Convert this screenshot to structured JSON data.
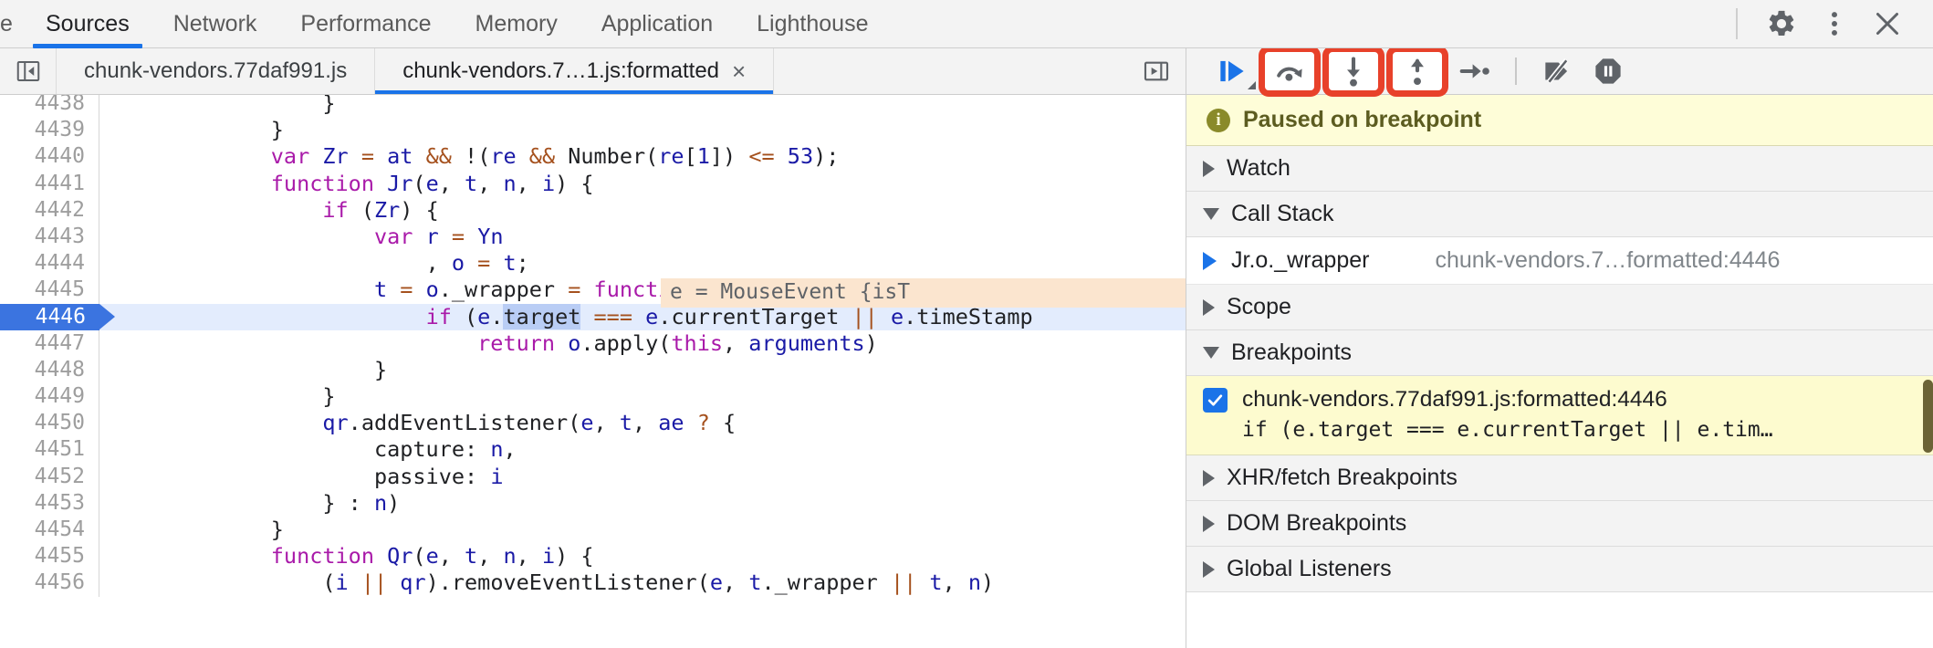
{
  "panel_tabs": [
    {
      "label": "e",
      "active": false,
      "clipped": true
    },
    {
      "label": "Sources",
      "active": true
    },
    {
      "label": "Network",
      "active": false
    },
    {
      "label": "Performance",
      "active": false
    },
    {
      "label": "Memory",
      "active": false
    },
    {
      "label": "Application",
      "active": false
    },
    {
      "label": "Lighthouse",
      "active": false
    }
  ],
  "window_controls": {
    "settings_icon": "gear-icon",
    "more_icon": "kebab-menu-icon",
    "close_icon": "close-icon"
  },
  "editor": {
    "navigator_toggle_icon": "show-navigator-icon",
    "more_tabs_icon": "more-tabs-icon",
    "tabs": [
      {
        "label": "chunk-vendors.77daf991.js",
        "active": false,
        "closable": false
      },
      {
        "label": "chunk-vendors.7…1.js:formatted",
        "active": true,
        "closable": true,
        "close_label": "×"
      }
    ],
    "inline_value_hint": "e = MouseEvent {isT",
    "execution_line": 4446,
    "selected_token": "target",
    "lines": [
      {
        "num": "4438",
        "indent": 8,
        "tokens": [
          {
            "t": "}",
            "c": "pln"
          }
        ],
        "partial_top": true
      },
      {
        "num": "4439",
        "indent": 6,
        "tokens": [
          {
            "t": "}",
            "c": "pln"
          }
        ]
      },
      {
        "num": "4440",
        "indent": 6,
        "tokens": [
          {
            "t": "var ",
            "c": "kw"
          },
          {
            "t": "Zr",
            "c": "id"
          },
          {
            "t": " ",
            "c": "pln"
          },
          {
            "t": "=",
            "c": "op"
          },
          {
            "t": " ",
            "c": "pln"
          },
          {
            "t": "at",
            "c": "id"
          },
          {
            "t": " ",
            "c": "pln"
          },
          {
            "t": "&&",
            "c": "op"
          },
          {
            "t": " ",
            "c": "pln"
          },
          {
            "t": "!(",
            "c": "pln"
          },
          {
            "t": "re",
            "c": "id"
          },
          {
            "t": " ",
            "c": "pln"
          },
          {
            "t": "&&",
            "c": "op"
          },
          {
            "t": " Number(",
            "c": "pln"
          },
          {
            "t": "re",
            "c": "id"
          },
          {
            "t": "[",
            "c": "pln"
          },
          {
            "t": "1",
            "c": "num"
          },
          {
            "t": "]) ",
            "c": "pln"
          },
          {
            "t": "<=",
            "c": "op"
          },
          {
            "t": " ",
            "c": "pln"
          },
          {
            "t": "53",
            "c": "num"
          },
          {
            "t": ");",
            "c": "pln"
          }
        ]
      },
      {
        "num": "4441",
        "indent": 6,
        "tokens": [
          {
            "t": "function ",
            "c": "kw"
          },
          {
            "t": "Jr",
            "c": "id"
          },
          {
            "t": "(",
            "c": "pln"
          },
          {
            "t": "e",
            "c": "id"
          },
          {
            "t": ", ",
            "c": "pln"
          },
          {
            "t": "t",
            "c": "id"
          },
          {
            "t": ", ",
            "c": "pln"
          },
          {
            "t": "n",
            "c": "id"
          },
          {
            "t": ", ",
            "c": "pln"
          },
          {
            "t": "i",
            "c": "id"
          },
          {
            "t": ") {",
            "c": "pln"
          }
        ]
      },
      {
        "num": "4442",
        "indent": 8,
        "tokens": [
          {
            "t": "if ",
            "c": "kw"
          },
          {
            "t": "(",
            "c": "pln"
          },
          {
            "t": "Zr",
            "c": "id"
          },
          {
            "t": ") {",
            "c": "pln"
          }
        ]
      },
      {
        "num": "4443",
        "indent": 10,
        "tokens": [
          {
            "t": "var ",
            "c": "kw"
          },
          {
            "t": "r",
            "c": "id"
          },
          {
            "t": " ",
            "c": "pln"
          },
          {
            "t": "=",
            "c": "op"
          },
          {
            "t": " ",
            "c": "pln"
          },
          {
            "t": "Yn",
            "c": "id"
          }
        ]
      },
      {
        "num": "4444",
        "indent": 12,
        "tokens": [
          {
            "t": ", ",
            "c": "pln"
          },
          {
            "t": "o",
            "c": "id"
          },
          {
            "t": " ",
            "c": "pln"
          },
          {
            "t": "=",
            "c": "op"
          },
          {
            "t": " ",
            "c": "pln"
          },
          {
            "t": "t",
            "c": "id"
          },
          {
            "t": ";",
            "c": "pln"
          }
        ]
      },
      {
        "num": "4445",
        "indent": 10,
        "tokens": [
          {
            "t": "t",
            "c": "id"
          },
          {
            "t": " ",
            "c": "pln"
          },
          {
            "t": "=",
            "c": "op"
          },
          {
            "t": " ",
            "c": "pln"
          },
          {
            "t": "o",
            "c": "id"
          },
          {
            "t": "._wrapper ",
            "c": "pln"
          },
          {
            "t": "=",
            "c": "op"
          },
          {
            "t": " ",
            "c": "pln"
          },
          {
            "t": "function",
            "c": "kw"
          },
          {
            "t": "(",
            "c": "pln"
          },
          {
            "t": "e",
            "c": "id"
          },
          {
            "t": ") {",
            "c": "pln"
          }
        ]
      },
      {
        "num": "4446",
        "indent": 12,
        "exec": true,
        "tokens": [
          {
            "t": "if ",
            "c": "kw"
          },
          {
            "t": "(",
            "c": "pln"
          },
          {
            "t": "e",
            "c": "id"
          },
          {
            "t": ".",
            "c": "pln"
          },
          {
            "t": "target",
            "c": "pln",
            "sel": true
          },
          {
            "t": " ",
            "c": "pln"
          },
          {
            "t": "===",
            "c": "op"
          },
          {
            "t": " ",
            "c": "pln"
          },
          {
            "t": "e",
            "c": "id"
          },
          {
            "t": ".currentTarget ",
            "c": "pln"
          },
          {
            "t": "||",
            "c": "op"
          },
          {
            "t": " ",
            "c": "pln"
          },
          {
            "t": "e",
            "c": "id"
          },
          {
            "t": ".timeStamp",
            "c": "pln"
          }
        ]
      },
      {
        "num": "4447",
        "indent": 14,
        "tokens": [
          {
            "t": "return ",
            "c": "kw"
          },
          {
            "t": "o",
            "c": "id"
          },
          {
            "t": ".apply(",
            "c": "pln"
          },
          {
            "t": "this",
            "c": "kw"
          },
          {
            "t": ", ",
            "c": "pln"
          },
          {
            "t": "arguments",
            "c": "id"
          },
          {
            "t": ")",
            "c": "pln"
          }
        ]
      },
      {
        "num": "4448",
        "indent": 10,
        "tokens": [
          {
            "t": "}",
            "c": "pln"
          }
        ]
      },
      {
        "num": "4449",
        "indent": 8,
        "tokens": [
          {
            "t": "}",
            "c": "pln"
          }
        ]
      },
      {
        "num": "4450",
        "indent": 8,
        "tokens": [
          {
            "t": "qr",
            "c": "id"
          },
          {
            "t": ".addEventListener(",
            "c": "pln"
          },
          {
            "t": "e",
            "c": "id"
          },
          {
            "t": ", ",
            "c": "pln"
          },
          {
            "t": "t",
            "c": "id"
          },
          {
            "t": ", ",
            "c": "pln"
          },
          {
            "t": "ae",
            "c": "id"
          },
          {
            "t": " ",
            "c": "pln"
          },
          {
            "t": "?",
            "c": "op"
          },
          {
            "t": " {",
            "c": "pln"
          }
        ]
      },
      {
        "num": "4451",
        "indent": 10,
        "tokens": [
          {
            "t": "capture: ",
            "c": "pln"
          },
          {
            "t": "n",
            "c": "id"
          },
          {
            "t": ",",
            "c": "pln"
          }
        ]
      },
      {
        "num": "4452",
        "indent": 10,
        "tokens": [
          {
            "t": "passive: ",
            "c": "pln"
          },
          {
            "t": "i",
            "c": "id"
          }
        ]
      },
      {
        "num": "4453",
        "indent": 8,
        "tokens": [
          {
            "t": "} : ",
            "c": "pln"
          },
          {
            "t": "n",
            "c": "id"
          },
          {
            "t": ")",
            "c": "pln"
          }
        ]
      },
      {
        "num": "4454",
        "indent": 6,
        "tokens": [
          {
            "t": "}",
            "c": "pln"
          }
        ]
      },
      {
        "num": "4455",
        "indent": 6,
        "tokens": [
          {
            "t": "function ",
            "c": "kw"
          },
          {
            "t": "Qr",
            "c": "id"
          },
          {
            "t": "(",
            "c": "pln"
          },
          {
            "t": "e",
            "c": "id"
          },
          {
            "t": ", ",
            "c": "pln"
          },
          {
            "t": "t",
            "c": "id"
          },
          {
            "t": ", ",
            "c": "pln"
          },
          {
            "t": "n",
            "c": "id"
          },
          {
            "t": ", ",
            "c": "pln"
          },
          {
            "t": "i",
            "c": "id"
          },
          {
            "t": ") {",
            "c": "pln"
          }
        ]
      },
      {
        "num": "4456",
        "indent": 8,
        "tokens": [
          {
            "t": "(",
            "c": "pln"
          },
          {
            "t": "i",
            "c": "id"
          },
          {
            "t": " ",
            "c": "pln"
          },
          {
            "t": "||",
            "c": "op"
          },
          {
            "t": " ",
            "c": "pln"
          },
          {
            "t": "qr",
            "c": "id"
          },
          {
            "t": ").removeEventListener(",
            "c": "pln"
          },
          {
            "t": "e",
            "c": "id"
          },
          {
            "t": ", ",
            "c": "pln"
          },
          {
            "t": "t",
            "c": "id"
          },
          {
            "t": "._wrapper ",
            "c": "pln"
          },
          {
            "t": "||",
            "c": "op"
          },
          {
            "t": " ",
            "c": "pln"
          },
          {
            "t": "t",
            "c": "id"
          },
          {
            "t": ", ",
            "c": "pln"
          },
          {
            "t": "n",
            "c": "id"
          },
          {
            "t": ")",
            "c": "pln"
          }
        ]
      }
    ]
  },
  "debugger": {
    "toolbar": [
      {
        "name": "resume-button",
        "icon": "resume-icon",
        "highlighted": false,
        "has_dropdown": true
      },
      {
        "name": "step-over-button",
        "icon": "step-over-icon",
        "highlighted": true
      },
      {
        "name": "step-into-button",
        "icon": "step-into-icon",
        "highlighted": true
      },
      {
        "name": "step-out-button",
        "icon": "step-out-icon",
        "highlighted": true
      },
      {
        "name": "step-button",
        "icon": "step-icon",
        "highlighted": false
      },
      {
        "name": "deactivate-breakpoints-button",
        "icon": "deactivate-breakpoints-icon",
        "highlighted": false
      },
      {
        "name": "pause-on-exceptions-button",
        "icon": "pause-on-exceptions-icon",
        "highlighted": false
      }
    ],
    "paused_banner": {
      "icon": "info-icon",
      "text": "Paused on breakpoint"
    },
    "sections": [
      {
        "name": "watch",
        "label": "Watch",
        "expanded": false
      },
      {
        "name": "call-stack",
        "label": "Call Stack",
        "expanded": true
      },
      {
        "name": "scope",
        "label": "Scope",
        "expanded": false
      },
      {
        "name": "breakpoints",
        "label": "Breakpoints",
        "expanded": true
      },
      {
        "name": "xhr-fetch-breakpoints",
        "label": "XHR/fetch Breakpoints",
        "expanded": false
      },
      {
        "name": "dom-breakpoints",
        "label": "DOM Breakpoints",
        "expanded": false
      },
      {
        "name": "global-listeners",
        "label": "Global Listeners",
        "expanded": false
      }
    ],
    "call_stack": [
      {
        "name": "Jr.o._wrapper",
        "location": "chunk-vendors.7…formatted:4446",
        "current": true
      }
    ],
    "breakpoints": [
      {
        "checked": true,
        "title": "chunk-vendors.77daf991.js:formatted:4446",
        "snippet": "if (e.target === e.currentTarget || e.tim…"
      }
    ]
  },
  "colors": {
    "accent": "#1a73e8",
    "highlight_ring": "#e8412a",
    "paused_bg": "#fefdd8",
    "breakpoint_bg": "#fdfbcf",
    "exec_line_bg": "#e3ecfd",
    "exec_gutter": "#3b74e0",
    "inline_hint_bg": "#fbe5cf"
  }
}
